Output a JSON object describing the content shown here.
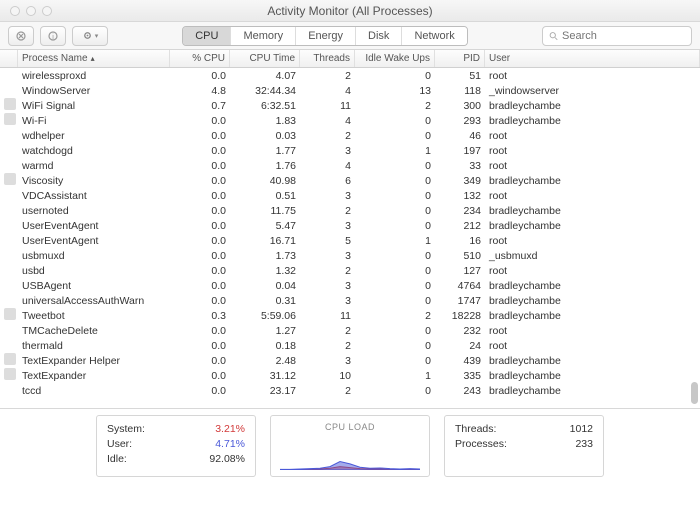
{
  "window": {
    "title": "Activity Monitor (All Processes)"
  },
  "toolbar": {
    "tabs": [
      "CPU",
      "Memory",
      "Energy",
      "Disk",
      "Network"
    ],
    "activeTab": 0,
    "searchPlaceholder": "Search"
  },
  "columns": {
    "name": "Process Name",
    "cpu": "% CPU",
    "time": "CPU Time",
    "threads": "Threads",
    "idle": "Idle Wake Ups",
    "pid": "PID",
    "user": "User"
  },
  "rows": [
    {
      "name": "tccd",
      "cpu": "0.0",
      "time": "23.17",
      "threads": "2",
      "idle": "0",
      "pid": "243",
      "user": "bradleychambe",
      "icon": false
    },
    {
      "name": "TextExpander",
      "cpu": "0.0",
      "time": "31.12",
      "threads": "10",
      "idle": "1",
      "pid": "335",
      "user": "bradleychambe",
      "icon": true
    },
    {
      "name": "TextExpander Helper",
      "cpu": "0.0",
      "time": "2.48",
      "threads": "3",
      "idle": "0",
      "pid": "439",
      "user": "bradleychambe",
      "icon": true
    },
    {
      "name": "thermald",
      "cpu": "0.0",
      "time": "0.18",
      "threads": "2",
      "idle": "0",
      "pid": "24",
      "user": "root",
      "icon": false
    },
    {
      "name": "TMCacheDelete",
      "cpu": "0.0",
      "time": "1.27",
      "threads": "2",
      "idle": "0",
      "pid": "232",
      "user": "root",
      "icon": false
    },
    {
      "name": "Tweetbot",
      "cpu": "0.3",
      "time": "5:59.06",
      "threads": "11",
      "idle": "2",
      "pid": "18228",
      "user": "bradleychambe",
      "icon": true
    },
    {
      "name": "universalAccessAuthWarn",
      "cpu": "0.0",
      "time": "0.31",
      "threads": "3",
      "idle": "0",
      "pid": "1747",
      "user": "bradleychambe",
      "icon": false
    },
    {
      "name": "USBAgent",
      "cpu": "0.0",
      "time": "0.04",
      "threads": "3",
      "idle": "0",
      "pid": "4764",
      "user": "bradleychambe",
      "icon": false
    },
    {
      "name": "usbd",
      "cpu": "0.0",
      "time": "1.32",
      "threads": "2",
      "idle": "0",
      "pid": "127",
      "user": "root",
      "icon": false
    },
    {
      "name": "usbmuxd",
      "cpu": "0.0",
      "time": "1.73",
      "threads": "3",
      "idle": "0",
      "pid": "510",
      "user": "_usbmuxd",
      "icon": false
    },
    {
      "name": "UserEventAgent",
      "cpu": "0.0",
      "time": "16.71",
      "threads": "5",
      "idle": "1",
      "pid": "16",
      "user": "root",
      "icon": false
    },
    {
      "name": "UserEventAgent",
      "cpu": "0.0",
      "time": "5.47",
      "threads": "3",
      "idle": "0",
      "pid": "212",
      "user": "bradleychambe",
      "icon": false
    },
    {
      "name": "usernoted",
      "cpu": "0.0",
      "time": "11.75",
      "threads": "2",
      "idle": "0",
      "pid": "234",
      "user": "bradleychambe",
      "icon": false
    },
    {
      "name": "VDCAssistant",
      "cpu": "0.0",
      "time": "0.51",
      "threads": "3",
      "idle": "0",
      "pid": "132",
      "user": "root",
      "icon": false
    },
    {
      "name": "Viscosity",
      "cpu": "0.0",
      "time": "40.98",
      "threads": "6",
      "idle": "0",
      "pid": "349",
      "user": "bradleychambe",
      "icon": true
    },
    {
      "name": "warmd",
      "cpu": "0.0",
      "time": "1.76",
      "threads": "4",
      "idle": "0",
      "pid": "33",
      "user": "root",
      "icon": false
    },
    {
      "name": "watchdogd",
      "cpu": "0.0",
      "time": "1.77",
      "threads": "3",
      "idle": "1",
      "pid": "197",
      "user": "root",
      "icon": false
    },
    {
      "name": "wdhelper",
      "cpu": "0.0",
      "time": "0.03",
      "threads": "2",
      "idle": "0",
      "pid": "46",
      "user": "root",
      "icon": false
    },
    {
      "name": "Wi-Fi",
      "cpu": "0.0",
      "time": "1.83",
      "threads": "4",
      "idle": "0",
      "pid": "293",
      "user": "bradleychambe",
      "icon": true
    },
    {
      "name": "WiFi Signal",
      "cpu": "0.7",
      "time": "6:32.51",
      "threads": "11",
      "idle": "2",
      "pid": "300",
      "user": "bradleychambe",
      "icon": true
    },
    {
      "name": "WindowServer",
      "cpu": "4.8",
      "time": "32:44.34",
      "threads": "4",
      "idle": "13",
      "pid": "118",
      "user": "_windowserver",
      "icon": false
    },
    {
      "name": "wirelessproxd",
      "cpu": "0.0",
      "time": "4.07",
      "threads": "2",
      "idle": "0",
      "pid": "51",
      "user": "root",
      "icon": false
    }
  ],
  "footer": {
    "systemLabel": "System:",
    "systemValue": "3.21%",
    "userLabel": "User:",
    "userValue": "4.71%",
    "idleLabel": "Idle:",
    "idleValue": "92.08%",
    "cpuLoadLabel": "CPU LOAD",
    "threadsLabel": "Threads:",
    "threadsValue": "1012",
    "processesLabel": "Processes:",
    "processesValue": "233"
  },
  "chart_data": {
    "type": "area",
    "title": "CPU LOAD",
    "ylim": [
      0,
      100
    ],
    "series": [
      {
        "name": "User",
        "color": "#4a58d8",
        "values": [
          2,
          2,
          3,
          4,
          5,
          10,
          25,
          18,
          8,
          5,
          6,
          4,
          3,
          4,
          3
        ]
      },
      {
        "name": "System",
        "color": "#d23a3a",
        "values": [
          1,
          1,
          2,
          2,
          3,
          5,
          10,
          7,
          4,
          3,
          3,
          2,
          2,
          2,
          2
        ]
      }
    ]
  }
}
